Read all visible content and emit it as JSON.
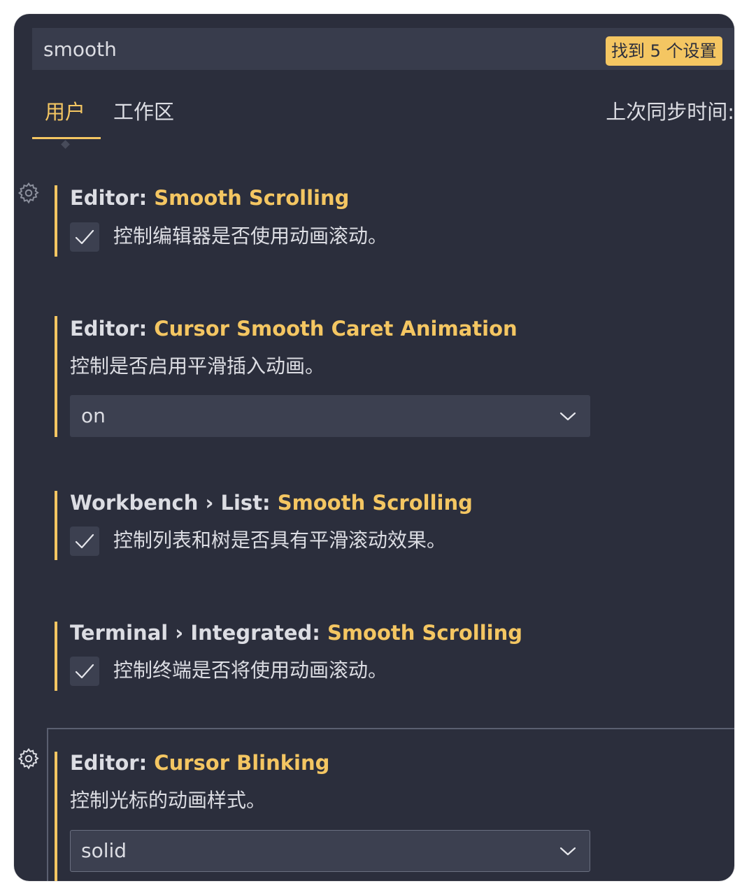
{
  "search": {
    "value": "smooth",
    "result_badge": "找到 5 个设置"
  },
  "tabs": [
    {
      "label": "用户",
      "active": true
    },
    {
      "label": "工作区",
      "active": false
    }
  ],
  "sync_label": "上次同步时间:",
  "accent_color": "#f4c662",
  "settings": [
    {
      "category": "Editor: ",
      "name": "Smooth Scrolling",
      "control": "checkbox",
      "checked": true,
      "description": "控制编辑器是否使用动画滚动。",
      "has_gear": true
    },
    {
      "category": "Editor: ",
      "name": "Cursor Smooth Caret Animation",
      "control": "select",
      "description": "控制是否启用平滑插入动画。",
      "value": "on",
      "has_gear": false
    },
    {
      "category": "Workbench › List: ",
      "name": "Smooth Scrolling",
      "control": "checkbox",
      "checked": true,
      "description": "控制列表和树是否具有平滑滚动效果。",
      "has_gear": false
    },
    {
      "category": "Terminal › Integrated: ",
      "name": "Smooth Scrolling",
      "control": "checkbox",
      "checked": true,
      "description": "控制终端是否将使用动画滚动。",
      "has_gear": false
    },
    {
      "category": "Editor: ",
      "name": "Cursor Blinking",
      "control": "select",
      "description": "控制光标的动画样式。",
      "value": "solid",
      "has_gear": true
    }
  ],
  "icons": {
    "gear": "gear-icon",
    "check": "check-icon",
    "dropdown": "chevron-down-icon"
  }
}
